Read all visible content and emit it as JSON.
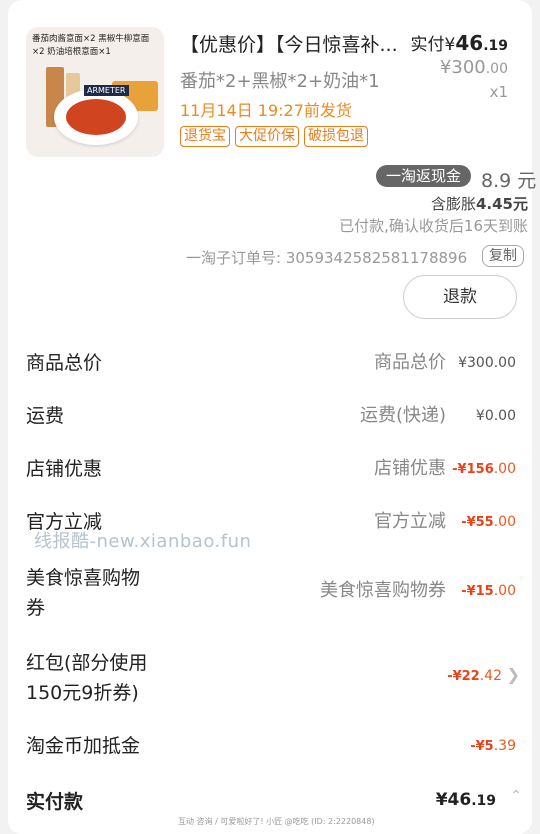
{
  "product": {
    "thumb_caption": "番茄肉酱意面×2 黑椒牛柳意面×2 奶油培根意面×1",
    "thumb_brand": "ARMETER",
    "title": "【优惠价】【今日惊喜补...",
    "paid_label": "实付",
    "paid_currency": "¥",
    "paid_int": "46",
    "paid_dec": ".19",
    "original_int": "¥300",
    "original_dec": ".00",
    "quantity": "x1",
    "spec": "番茄*2+黑椒*2+奶油*1",
    "ship_time": "11月14日 19:27前发货",
    "tags": [
      "退货宝",
      "大促价保",
      "破损包退"
    ]
  },
  "cashback": {
    "label": "一淘返现金",
    "value": "8.9 元",
    "inflate_label": "含膨胀",
    "inflate_value": "4.45元",
    "note": "已付款,确认收货后16天到账"
  },
  "order": {
    "number_label": "一淘子订单号: 3059342582581178896",
    "copy_label": "复制",
    "refund_label": "退款"
  },
  "breakdown": [
    {
      "label": "商品总价",
      "mid": "商品总价",
      "amount_main": "¥300",
      "amount_dec": ".00",
      "red": false
    },
    {
      "label": "运费",
      "mid": "运费(快递)",
      "amount_main": "¥0",
      "amount_dec": ".00",
      "red": false
    },
    {
      "label": "店铺优惠",
      "mid": "店铺优惠",
      "amount_main": "-¥156",
      "amount_dec": ".00",
      "red": true
    },
    {
      "label": "官方立减",
      "mid": "官方立减",
      "amount_main": "-¥55",
      "amount_dec": ".00",
      "red": true
    },
    {
      "label": "美食惊喜购物\n券",
      "mid": "美食惊喜购物券",
      "amount_main": "-¥15",
      "amount_dec": ".00",
      "red": true
    },
    {
      "label": "红包(部分使用\n150元9折券)",
      "mid": "",
      "amount_main": "-¥22",
      "amount_dec": ".42",
      "red": true
    },
    {
      "label": "淘金币加抵金",
      "mid": "",
      "amount_main": "-¥5",
      "amount_dec": ".39",
      "red": true
    }
  ],
  "total": {
    "label": "实付款",
    "amount_main": "¥46",
    "amount_dec": ".19"
  },
  "watermark": "线报酷-new.xianbao.fun",
  "footnote": "互动 咨询 / 可爱啦好了! 小匠 @吃吃 (ID: 2:2220848)",
  "colors": {
    "accent_orange": "#ee8a1f",
    "discount_red": "#e8431a"
  }
}
